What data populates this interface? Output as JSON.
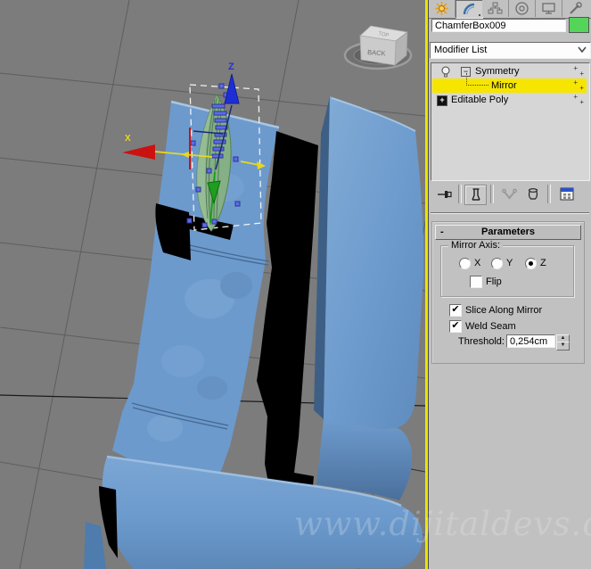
{
  "command_panel": {
    "tabs": [
      {
        "icon": "create-sunburst-icon",
        "active": false
      },
      {
        "icon": "modify-arc-icon",
        "active": true
      },
      {
        "icon": "hierarchy-icon",
        "active": false
      },
      {
        "icon": "motion-icon",
        "active": false
      },
      {
        "icon": "display-icon",
        "active": false
      },
      {
        "icon": "utilities-icon",
        "active": false
      }
    ],
    "object_name": "ChamferBox009",
    "object_color": "#55D45A",
    "modifier_list": {
      "label": "Modifier List",
      "dropdown_arrow_glyph": "v"
    },
    "modifier_stack": {
      "selection_color": "#F6E500",
      "tree_collapse_glyph": "−",
      "tree_expand_glyph": "+",
      "row_plus_glyph": "+",
      "items": [
        {
          "label": "Symmetry",
          "expanded": true,
          "enabled_icon": "bulb-icon"
        },
        {
          "label": "Mirror",
          "selected": true,
          "child": true
        },
        {
          "label": "Editable Poly",
          "collapsed": true
        }
      ]
    },
    "stack_toolbar": {
      "buttons": [
        {
          "icon": "pin-stack-icon",
          "state": "normal"
        },
        {
          "icon": "show-end-result-icon",
          "state": "on"
        },
        {
          "icon": "make-unique-icon",
          "state": "disabled"
        },
        {
          "icon": "remove-modifier-icon",
          "state": "normal"
        },
        {
          "icon": "configure-modifier-sets-icon",
          "state": "normal"
        }
      ]
    },
    "parameters_rollout": {
      "collapse_glyph": "-",
      "title": "Parameters",
      "mirror_axis": {
        "group_label": "Mirror Axis:",
        "options": [
          {
            "label": "X",
            "selected": false
          },
          {
            "label": "Y",
            "selected": false
          },
          {
            "label": "Z",
            "selected": true
          }
        ],
        "flip": {
          "label": "Flip",
          "checked": false
        }
      },
      "slice_along_mirror": {
        "label": "Slice Along Mirror",
        "checked": true,
        "check_glyph": "✔"
      },
      "weld_seam": {
        "label": "Weld Seam",
        "checked": true,
        "check_glyph": "✔"
      },
      "threshold": {
        "label": "Threshold:",
        "value": "0,254cm",
        "spin_up_glyph": "▲",
        "spin_down_glyph": "▼"
      }
    }
  },
  "viewport": {
    "background_color": "#7C7C7C",
    "grid_color": "#5E5E5E",
    "active_border_color": "#E8E600",
    "sofa_color": "#6C9ACD",
    "gizmo": {
      "x_label": "X",
      "z_label": "Z",
      "object_color": "#85B085"
    },
    "viewcube": {
      "front_label": "BACK",
      "top_label": "TOP"
    },
    "watermark": "www.dijitaldevs.com"
  }
}
